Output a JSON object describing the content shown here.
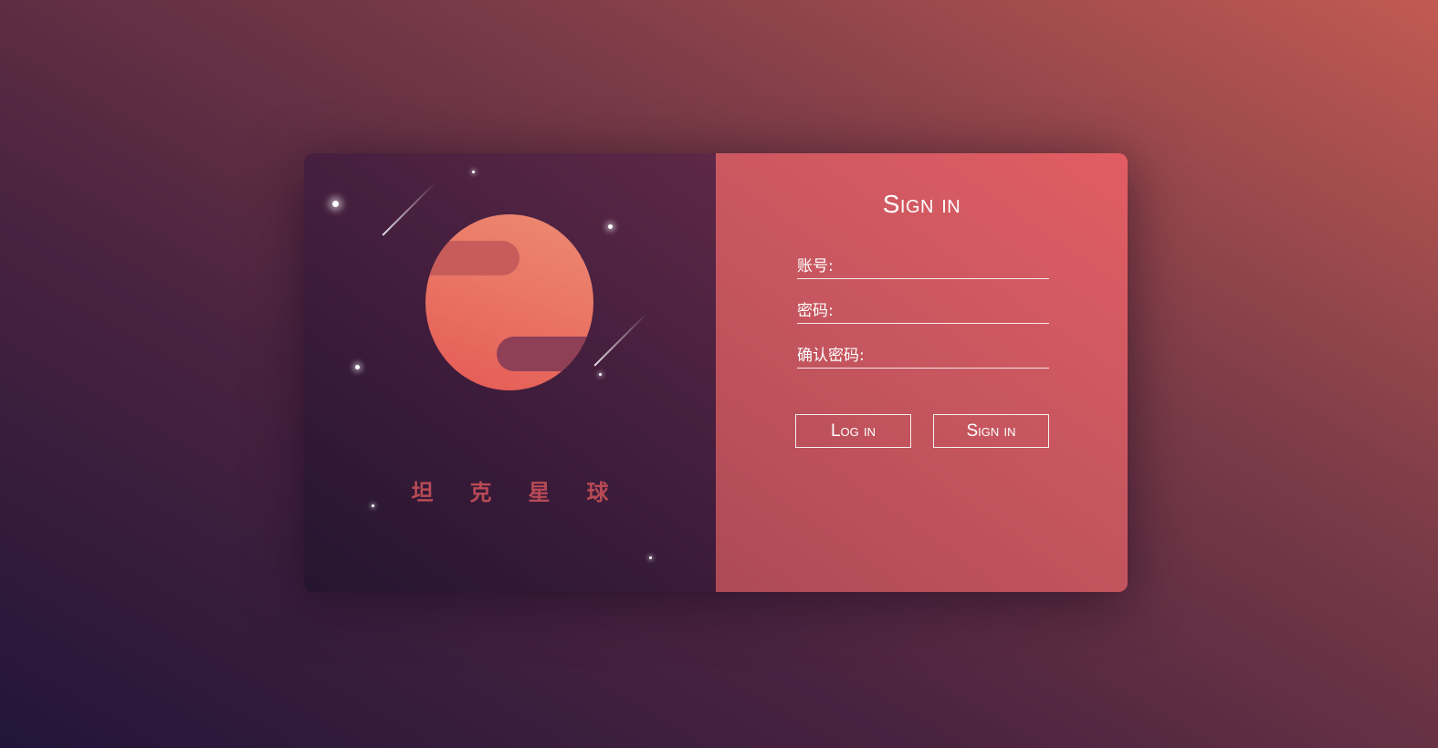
{
  "brand": {
    "name": "坦克星球"
  },
  "form": {
    "title": "Sign in",
    "fields": [
      {
        "label": "账号:"
      },
      {
        "label": "密码:"
      },
      {
        "label": "确认密码:"
      }
    ],
    "buttons": {
      "login_label": "Log in",
      "signin_label": "Sign in"
    }
  },
  "colors": {
    "accent": "#d95c62",
    "brand_text": "#b84a55",
    "planet": "#e8705f",
    "left_panel": "#3d1c3b"
  }
}
